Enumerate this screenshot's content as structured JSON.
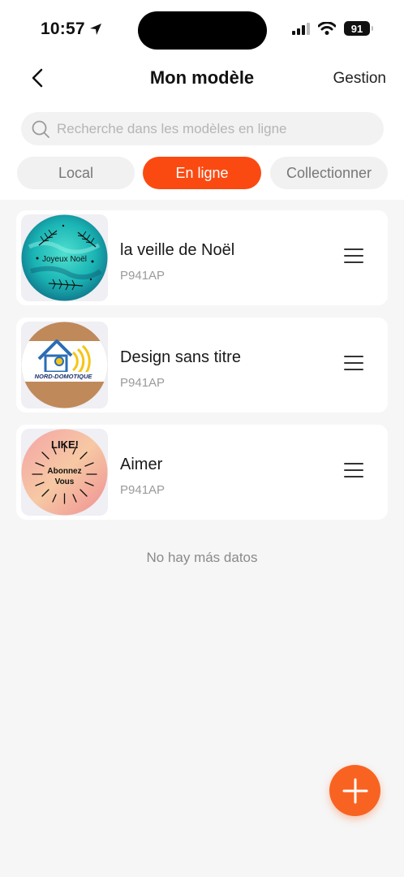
{
  "status_bar": {
    "time": "10:57",
    "battery": "91"
  },
  "nav": {
    "title": "Mon modèle",
    "action": "Gestion"
  },
  "search": {
    "placeholder": "Recherche dans les modèles en ligne",
    "value": ""
  },
  "tabs": [
    {
      "label": "Local",
      "active": false
    },
    {
      "label": "En ligne",
      "active": true
    },
    {
      "label": "Collectionner",
      "active": false
    }
  ],
  "items": [
    {
      "title": "la veille de Noël",
      "subtitle": "P941AP",
      "thumb_text": "Joyeux Noël"
    },
    {
      "title": "Design sans titre",
      "subtitle": "P941AP",
      "thumb_text": "NORD-DOMOTIQUE"
    },
    {
      "title": "Aimer",
      "subtitle": "P941AP",
      "thumb_text_1": "LIKE!",
      "thumb_text_2": "Abonnez",
      "thumb_text_3": "Vous"
    }
  ],
  "end_message": "No hay más datos",
  "colors": {
    "accent": "#fa4a12",
    "fab": "#f96322"
  }
}
